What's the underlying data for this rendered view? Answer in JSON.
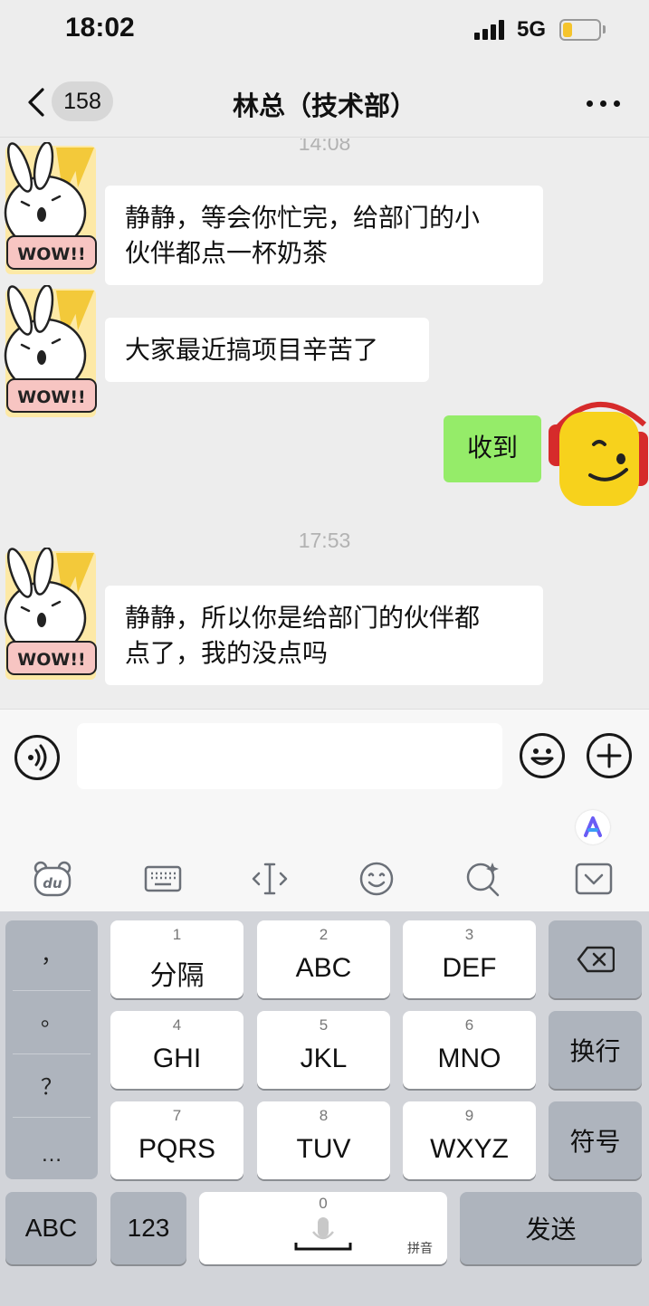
{
  "status_bar": {
    "time": "18:02",
    "network": "5G"
  },
  "nav": {
    "unread_count": "158",
    "title": "林总（技术部）"
  },
  "chat": {
    "messages": [
      {
        "timestamp": "14:08"
      },
      {
        "sender": "林总",
        "text_line1": "静静，等会你忙完，给部门的小",
        "text_line2": "伙伴都点一杯奶茶",
        "avatar_text": "WOW!!"
      },
      {
        "sender": "林总",
        "text": "大家最近搞项目辛苦了",
        "avatar_text": "WOW!!"
      },
      {
        "sender": "me",
        "text": "收到"
      },
      {
        "timestamp": "17:53"
      },
      {
        "sender": "林总",
        "text_line1": "静静，所以你是给部门的伙伴都",
        "text_line2": "点了，我的没点吗",
        "avatar_text": "WOW!!"
      }
    ]
  },
  "keyboard": {
    "punctuation": [
      "，",
      "。",
      "？",
      "…"
    ],
    "keys": [
      {
        "num": "1",
        "label": "分隔"
      },
      {
        "num": "2",
        "label": "ABC"
      },
      {
        "num": "3",
        "label": "DEF"
      },
      {
        "num": "4",
        "label": "GHI"
      },
      {
        "num": "5",
        "label": "JKL"
      },
      {
        "num": "6",
        "label": "MNO"
      },
      {
        "num": "7",
        "label": "PQRS"
      },
      {
        "num": "8",
        "label": "TUV"
      },
      {
        "num": "9",
        "label": "WXYZ"
      }
    ],
    "enter_label": "换行",
    "symbols_label": "符号",
    "abc_label": "ABC",
    "num_label": "123",
    "space_num": "0",
    "space_hint": "拼音",
    "send_label": "发送"
  },
  "colors": {
    "my_bubble": "#95ec69",
    "chat_bg": "#ededed",
    "battery": "#f5c42c"
  }
}
